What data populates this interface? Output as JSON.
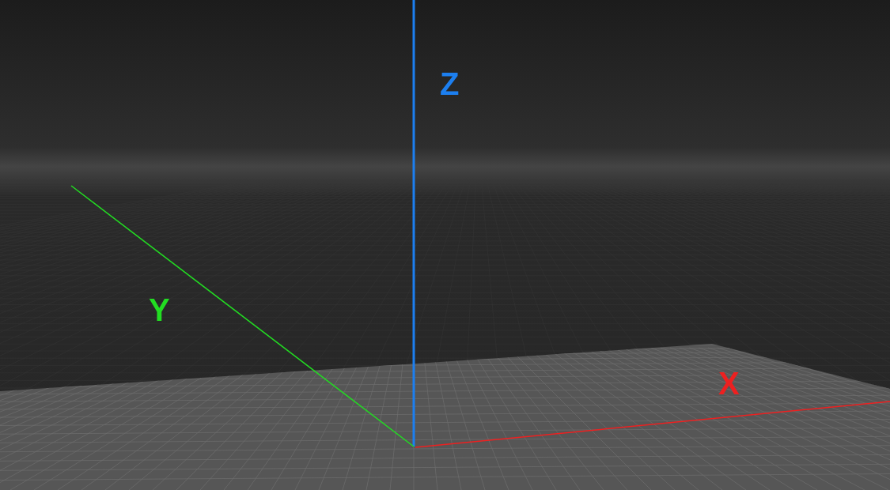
{
  "viewport": {
    "axes": [
      {
        "kind": "z",
        "label": "Z",
        "color": "#1c7ff0"
      },
      {
        "kind": "y",
        "label": "Y",
        "color": "#22dd22"
      },
      {
        "kind": "x",
        "label": "X",
        "color": "#ee2020"
      }
    ]
  }
}
